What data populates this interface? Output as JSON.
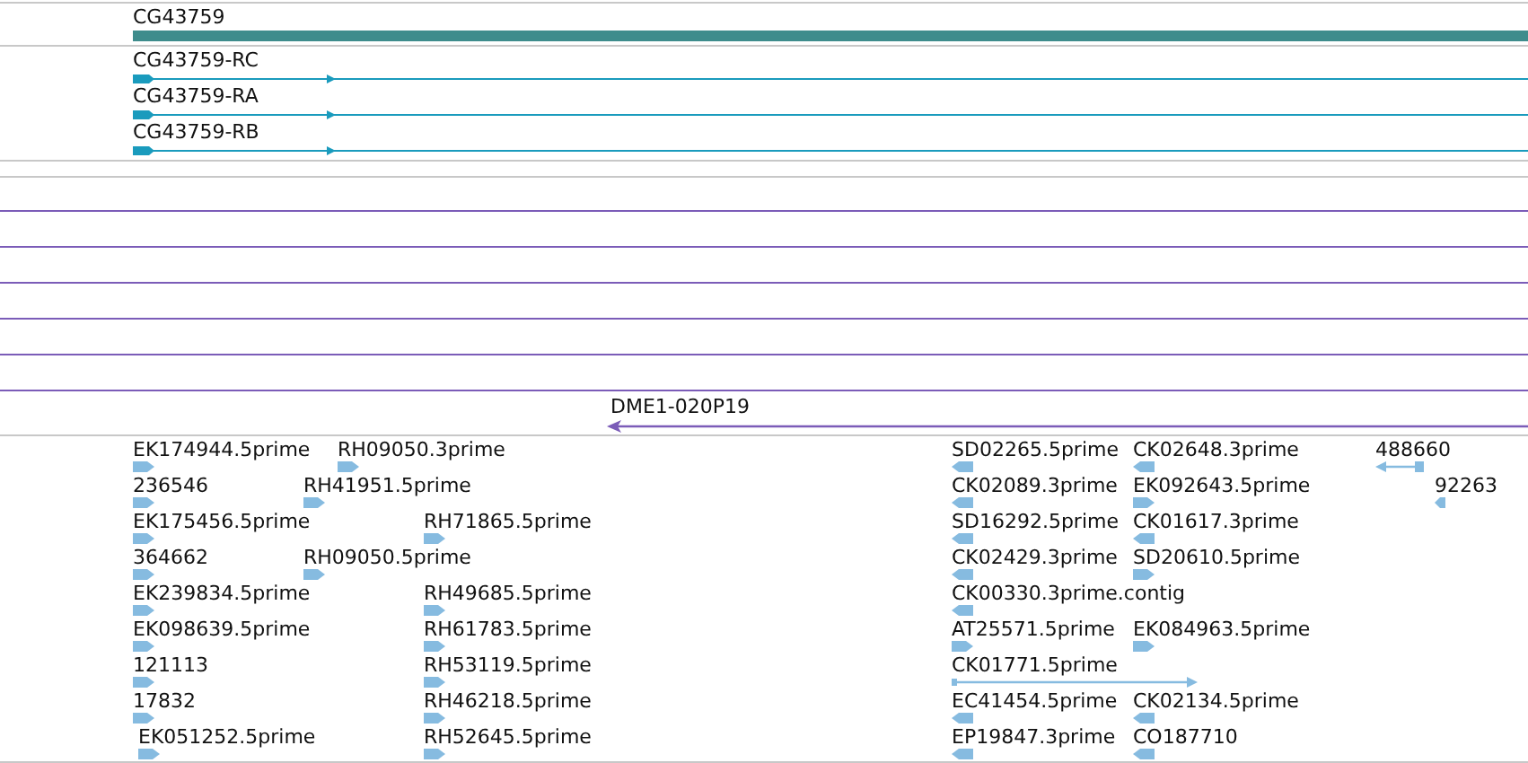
{
  "gene": {
    "label": "CG43759"
  },
  "transcripts": [
    {
      "label": "CG43759-RC",
      "reverse": false
    },
    {
      "label": "CG43759-RA",
      "reverse": false
    },
    {
      "label": "CG43759-RB",
      "reverse": false
    }
  ],
  "clone": {
    "label": "DME1-020P19",
    "reverse": true
  },
  "est_rows": [
    {
      "features": [
        {
          "label": "EK174944.5prime",
          "reverse": false
        },
        {
          "label": "RH09050.3prime",
          "reverse": false
        },
        {
          "label": "SD02265.5prime",
          "reverse": true
        },
        {
          "label": "CK02648.3prime",
          "reverse": true
        },
        {
          "label": "488660",
          "reverse": true
        }
      ]
    },
    {
      "features": [
        {
          "label": "236546",
          "reverse": false
        },
        {
          "label": "RH41951.5prime",
          "reverse": false
        },
        {
          "label": "CK02089.3prime",
          "reverse": true
        },
        {
          "label": "EK092643.5prime",
          "reverse": false
        },
        {
          "label": "92263",
          "reverse": true
        }
      ]
    },
    {
      "features": [
        {
          "label": "EK175456.5prime",
          "reverse": false
        },
        {
          "label": "RH71865.5prime",
          "reverse": false
        },
        {
          "label": "SD16292.5prime",
          "reverse": true
        },
        {
          "label": "CK01617.3prime",
          "reverse": true
        }
      ]
    },
    {
      "features": [
        {
          "label": "364662",
          "reverse": false
        },
        {
          "label": "RH09050.5prime",
          "reverse": false
        },
        {
          "label": "CK02429.3prime",
          "reverse": true
        },
        {
          "label": "SD20610.5prime",
          "reverse": false
        }
      ]
    },
    {
      "features": [
        {
          "label": "EK239834.5prime",
          "reverse": false
        },
        {
          "label": "RH49685.5prime",
          "reverse": false
        },
        {
          "label": "CK00330.3prime.contig",
          "reverse": true
        }
      ]
    },
    {
      "features": [
        {
          "label": "EK098639.5prime",
          "reverse": false
        },
        {
          "label": "RH61783.5prime",
          "reverse": false
        },
        {
          "label": "AT25571.5prime",
          "reverse": false
        },
        {
          "label": "EK084963.5prime",
          "reverse": false
        }
      ]
    },
    {
      "features": [
        {
          "label": "121113",
          "reverse": false
        },
        {
          "label": "RH53119.5prime",
          "reverse": false
        },
        {
          "label": "CK01771.5prime",
          "reverse": false
        }
      ]
    },
    {
      "features": [
        {
          "label": "17832",
          "reverse": false
        },
        {
          "label": "RH46218.5prime",
          "reverse": false
        },
        {
          "label": "EC41454.5prime",
          "reverse": true
        },
        {
          "label": "CK02134.5prime",
          "reverse": true
        }
      ]
    },
    {
      "features": [
        {
          "label": "EK051252.5prime",
          "reverse": false
        },
        {
          "label": "RH52645.5prime",
          "reverse": false
        },
        {
          "label": "EP19847.3prime",
          "reverse": true
        },
        {
          "label": "CO187710",
          "reverse": true
        }
      ]
    }
  ]
}
